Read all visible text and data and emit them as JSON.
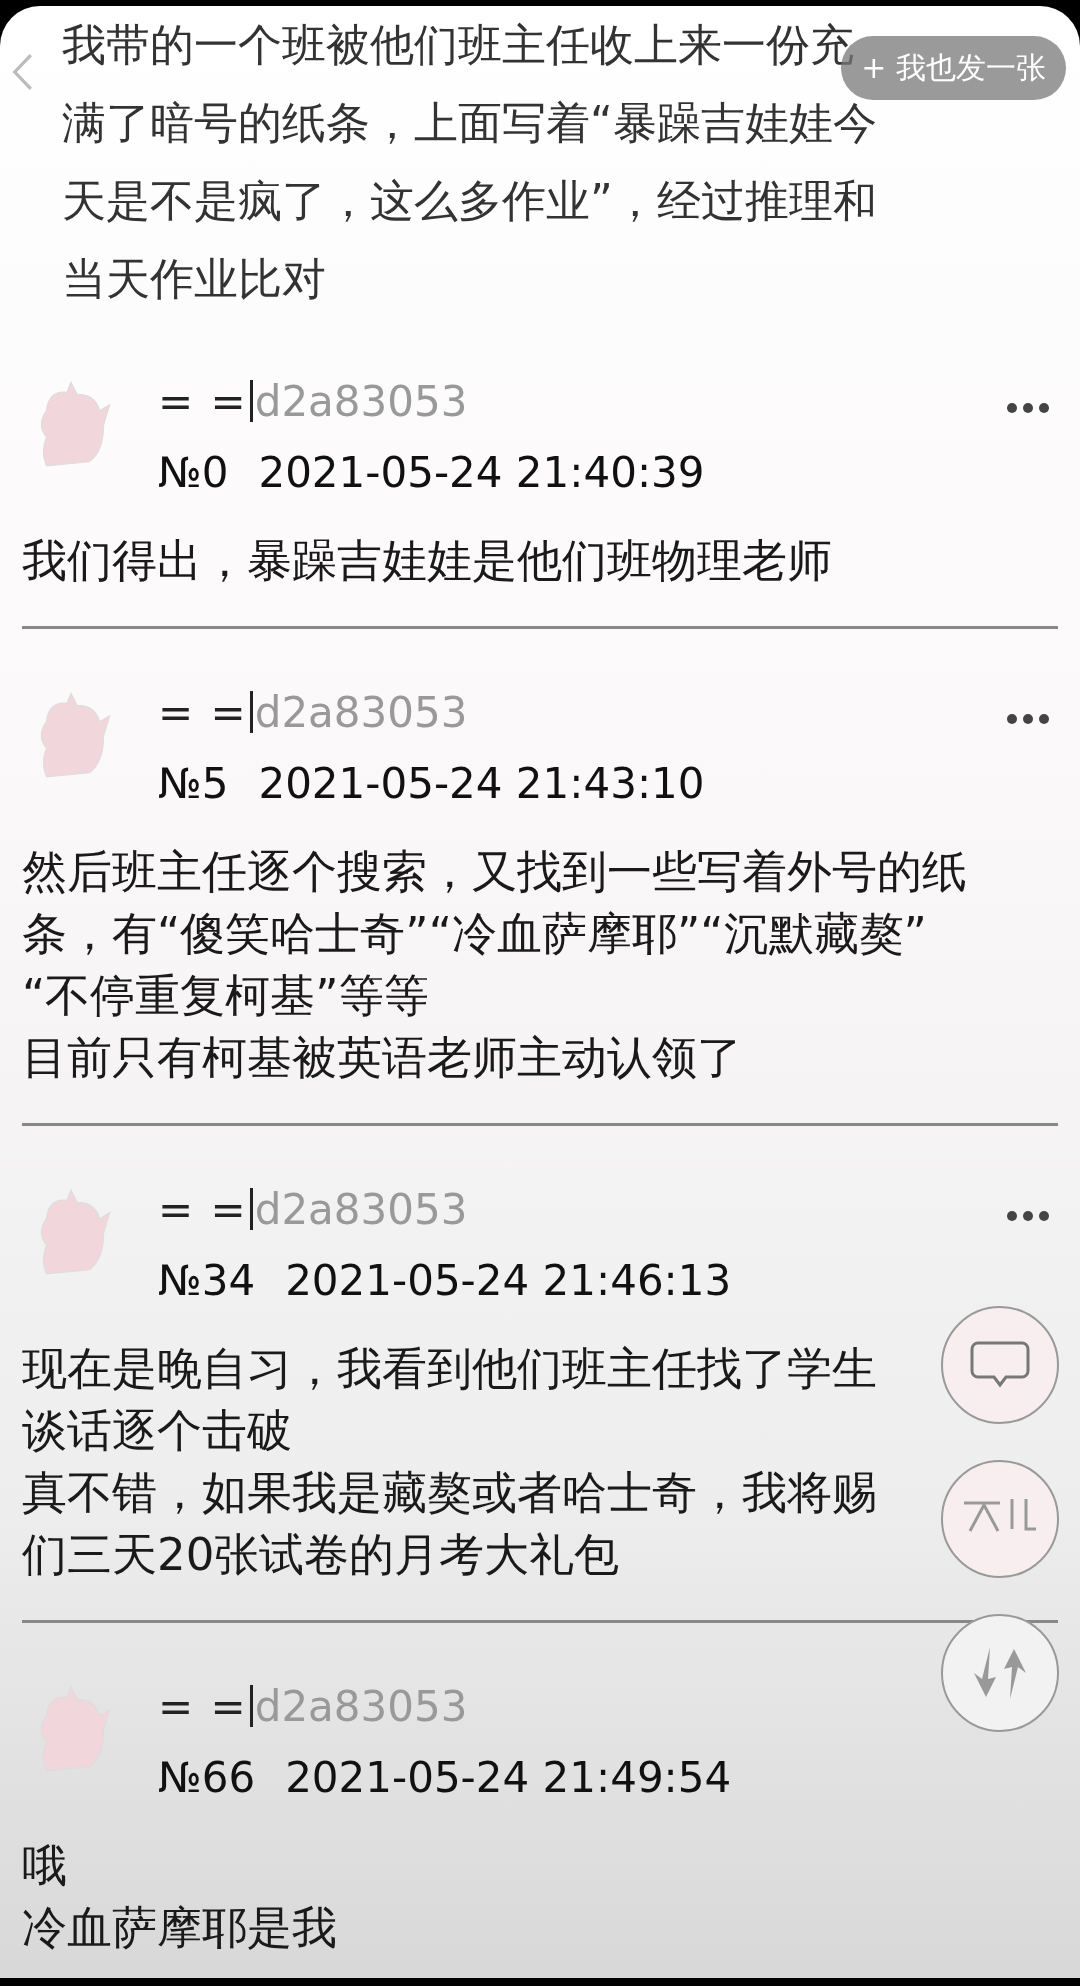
{
  "top_bar": {
    "post_button": "+ 我也发一张"
  },
  "intro": [
    "我带的一个班被他们班主任收上来一份充",
    "满了暗号的纸条，上面写着“暴躁吉娃娃今",
    "天是不是疯了，这么多作业”，经过推理和",
    "当天作业比对"
  ],
  "replies": [
    {
      "user": "= =",
      "user_id": "d2a83053",
      "floor": "№0",
      "time": "2021-05-24 21:40:39",
      "menu": true,
      "lines": [
        "我们得出，暴躁吉娃娃是他们班物理老师"
      ]
    },
    {
      "user": "= =",
      "user_id": "d2a83053",
      "floor": "№5",
      "time": "2021-05-24 21:43:10",
      "menu": true,
      "lines": [
        "然后班主任逐个搜索，又找到一些写着外号的纸",
        "条，有“傻笑哈士奇”“冷血萨摩耶”“沉默藏獒”",
        "“不停重复柯基”等等",
        "目前只有柯基被英语老师主动认领了"
      ]
    },
    {
      "user": "= =",
      "user_id": "d2a83053",
      "floor": "№34",
      "time": "2021-05-24 21:46:13",
      "menu": true,
      "lines": [
        "现在是晚自习，我看到他们班主任找了学生",
        "谈话逐个击破",
        "真不错，如果我是藏獒或者哈士奇，我将赐",
        "们三天20张试卷的月考大礼包"
      ]
    },
    {
      "user": "= =",
      "user_id": "d2a83053",
      "floor": "№66",
      "time": "2021-05-24 21:49:54",
      "menu": false,
      "lines": [
        "哦",
        "冷血萨摩耶是我"
      ]
    }
  ],
  "floating_buttons": [
    {
      "kind": "comment"
    },
    {
      "kind": "peak"
    },
    {
      "kind": "swap"
    }
  ]
}
